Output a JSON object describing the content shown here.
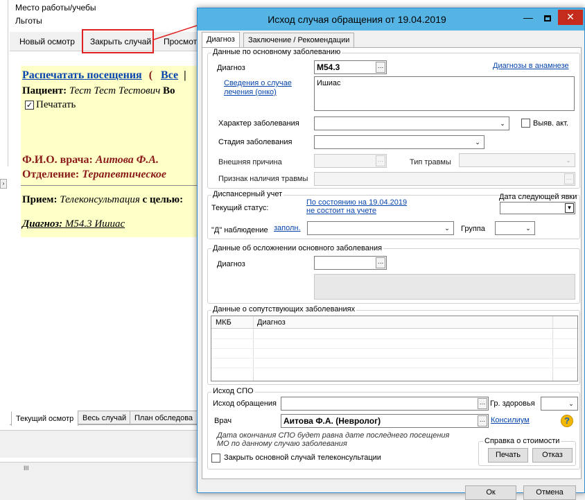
{
  "background": {
    "sidebar": {
      "workplace": "Место работы/учебы",
      "benefits": "Льготы"
    },
    "toolbar": {
      "new_exam": "Новый осмотр",
      "close_case": "Закрыть случай",
      "view": "Просмот"
    },
    "content": {
      "print_visits": "Распечатать посещения",
      "paren": "(",
      "all": "Все",
      "sep": "|",
      "patient_label": "Пациент:",
      "patient_name": "Тест Тест Тестович",
      "patient_tail": "Во",
      "print_checkbox": "Печатать",
      "doctor_label": "Ф.И.О. врача:",
      "doctor_name": "Аитова Ф.А.",
      "department_label": "Отделение:",
      "department_name": "Терапевтическое",
      "reception_label": "Прием:",
      "reception_type": "Телеконсультация",
      "reception_purpose": "с целью:",
      "diagnosis_label": "Диагноз:",
      "diagnosis_value": "М54.3 Ишиас"
    },
    "bottom_tabs": [
      "Текущий осмотр",
      "Весь случай",
      "План обследова"
    ],
    "statusbar_grip": "III"
  },
  "dialog": {
    "title": "Исход случая обращения от 19.04.2019",
    "tabs": {
      "diagnosis": "Диагноз",
      "conclusion": "Заключение / Рекомендации"
    },
    "main_disease": {
      "group_title": "Данные по основному заболеванию",
      "diagnosis_label": "Диагноз",
      "diagnosis_code": "M54.3",
      "history_link": "Диагнозы в анамнезе",
      "onco_link": "Сведения о случае лечения (онко)",
      "diagnosis_text": "Ишиас",
      "character_label": "Характер заболевания",
      "detected_label": "Выяв. акт.",
      "stage_label": "Стадия заболевания",
      "external_cause_label": "Внешняя причина",
      "injury_type_label": "Тип травмы",
      "injury_sign_label": "Признак наличия травмы"
    },
    "dispensary": {
      "group_title": "Диспансерный учет",
      "status_label": "Текущий статус:",
      "status_date_link": "По состоянию на 19.04.2019",
      "status_value_link": "не состоит на учете",
      "next_visit_label": "Дата следующей явки",
      "observation_label": "\"Д\" наблюдение",
      "fill_link": "заполн.",
      "group_label": "Группа"
    },
    "complication": {
      "group_title": "Данные об осложнении основного заболевания",
      "diagnosis_label": "Диагноз"
    },
    "comorbid": {
      "group_title": "Данные о сопутствующих заболеваниях",
      "columns": [
        "МКБ",
        "Диагноз"
      ]
    },
    "outcome": {
      "group_title": "Исход СПО",
      "outcome_label": "Исход обращения",
      "health_group_label": "Гр. здоровья",
      "doctor_label": "Врач",
      "doctor_value": "Аитова Ф.А. (Невролог)",
      "consilium_link": "Консилиум",
      "note_line1": "Дата окончания СПО будет равна дате последнего посещения",
      "note_line2": "МО по данному случаю заболевания",
      "cost_title": "Справка о стоимости",
      "print_button": "Печать",
      "refuse_button": "Отказ",
      "close_teleconsult_label": "Закрыть основной случай телеконсультации"
    },
    "footer": {
      "ok": "Ок",
      "cancel": "Отмена"
    }
  },
  "colors": {
    "titlebar": "#56b4e4",
    "close_button": "#c42b1c",
    "highlight_box": "#e02020",
    "link": "#0645ad",
    "content_bg": "#ffffc8",
    "doctor_text": "#8b1a1a"
  }
}
